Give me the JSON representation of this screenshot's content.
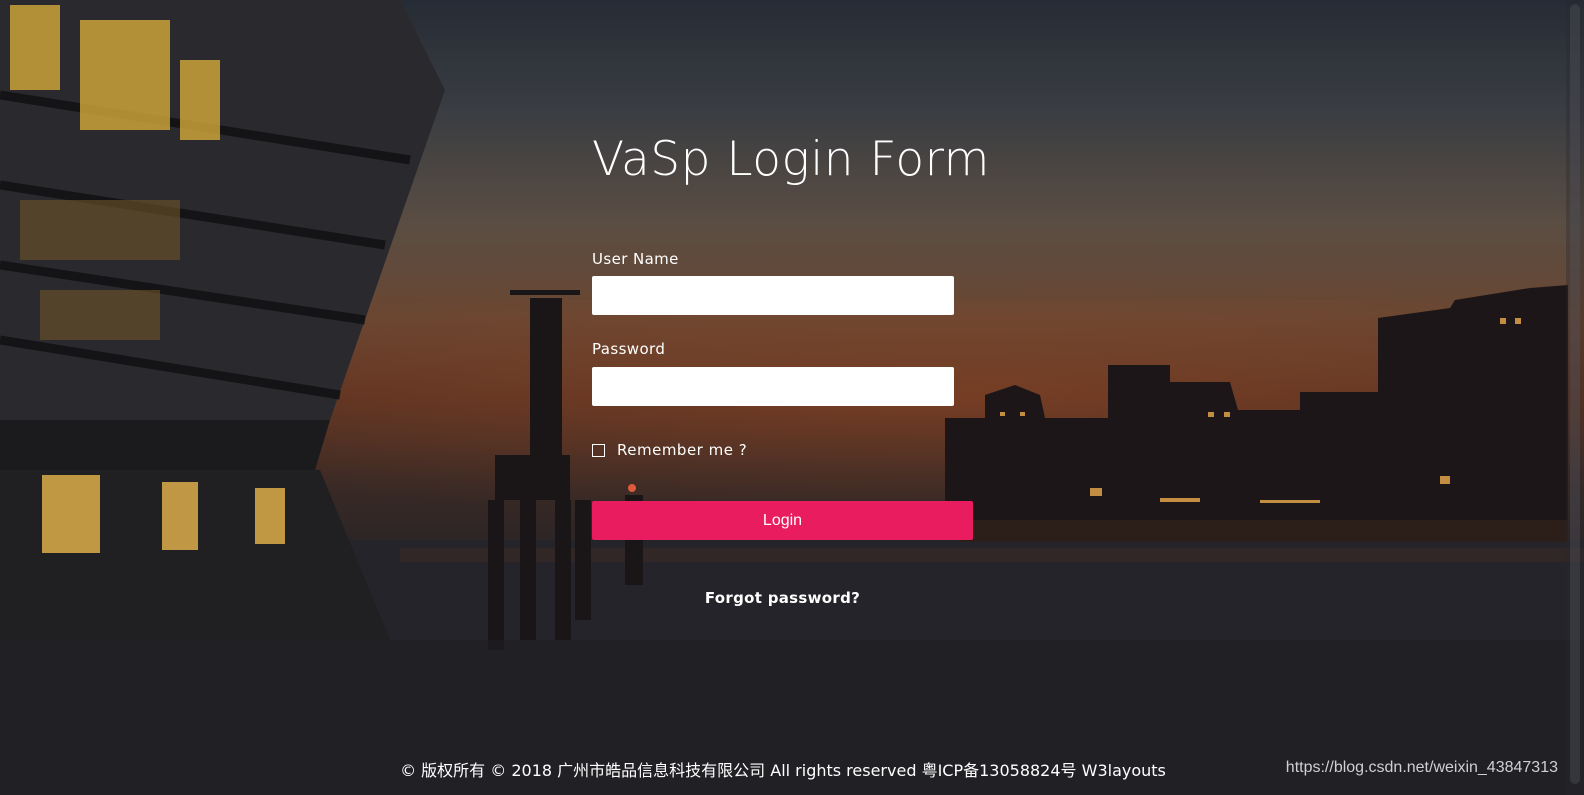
{
  "form": {
    "title": "VaSp Login Form",
    "username_label": "User Name",
    "username_value": "",
    "password_label": "Password",
    "password_value": "",
    "remember_label": "Remember me ?",
    "remember_checked": false,
    "login_label": "Login",
    "forgot_label": "Forgot password?"
  },
  "footer": {
    "copyright": "© 版权所有 © 2018 广州市皓品信息科技有限公司 All rights reserved 粤ICP备13058824号 W3layouts"
  },
  "watermark": {
    "text": "https://blog.csdn.net/weixin_43847313"
  },
  "colors": {
    "accent": "#e81c5f",
    "text": "#ffffff",
    "input_background": "#ffffff"
  },
  "background": {
    "description_icon": "night-harbor-photo"
  }
}
